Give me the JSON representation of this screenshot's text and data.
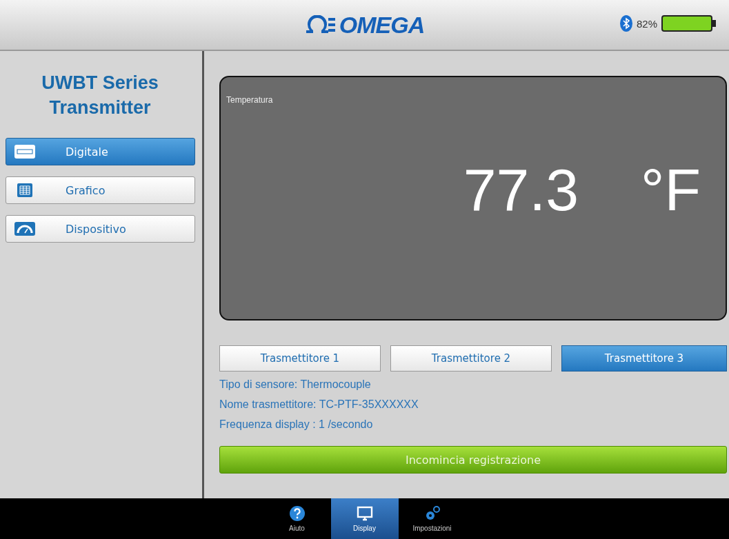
{
  "header": {
    "logo": "OMEGA",
    "battery": "82%"
  },
  "sidebar": {
    "title": "UWBT Series Transmitter",
    "items": [
      {
        "label": "Digitale",
        "kind": "digits",
        "selected": true
      },
      {
        "label": "Grafico",
        "kind": "grid",
        "selected": false
      },
      {
        "label": "Dispositivo",
        "kind": "gauge",
        "selected": false
      }
    ]
  },
  "display": {
    "label": "Temperatura",
    "value": "77.3",
    "unit": "°F"
  },
  "transmitters": [
    {
      "label": "Trasmettitore 1",
      "selected": false
    },
    {
      "label": "Trasmettitore 2",
      "selected": false
    },
    {
      "label": "Trasmettitore 3",
      "selected": true
    }
  ],
  "info": [
    "Tipo di sensore: Thermocouple",
    "Nome trasmettitore: TC-PTF-35XXXXXX",
    "Frequenza display : 1 /secondo"
  ],
  "record_button": "Incomincia registrazione",
  "tab_bar": [
    {
      "label": "Aiuto",
      "kind": "help",
      "selected": false
    },
    {
      "label": "Display",
      "kind": "monitor",
      "selected": true
    },
    {
      "label": "Impostazioni",
      "kind": "gears",
      "selected": false
    }
  ]
}
